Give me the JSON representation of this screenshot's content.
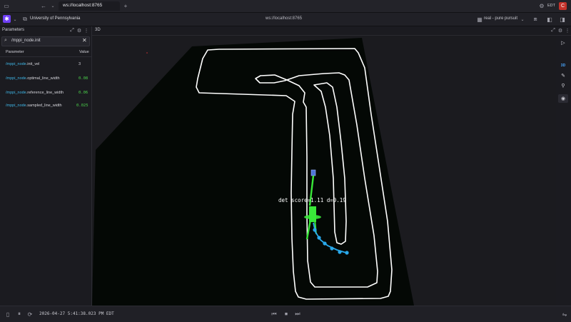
{
  "browser": {
    "tab_title": "ws://localhost:8765",
    "timezone_badge": "EDT",
    "profile_initial": "C",
    "new_tab_symbol": "+"
  },
  "appbar": {
    "org_name": "University of Pennsylvania",
    "url": "ws://localhost:8765",
    "layout_name": "real - pure pursuit"
  },
  "parameters_panel": {
    "title": "Parameters",
    "search_value": "/mppi_node.init",
    "columns": [
      "Parameter",
      "Value"
    ],
    "rows": [
      {
        "ns": "/mppi_node",
        "name": ".init_vel",
        "value": "3"
      },
      {
        "ns": "/mppi_node",
        "name": ".optimal_line_width",
        "value": "0.08"
      },
      {
        "ns": "/mppi_node",
        "name": ".reference_line_width",
        "value": "0.06"
      },
      {
        "ns": "/mppi_node",
        "name": ".sampled_line_width",
        "value": "0.025"
      }
    ]
  },
  "view3d": {
    "title": "3D",
    "overlay_text": "det score=1.11 d=0.19",
    "toolbar_mode": "3D"
  },
  "status": {
    "timestamp": "2026-04-27 5:41:38.023 PM EDT"
  },
  "colors": {
    "accent": "#6f3ff5",
    "track": "#ffffff",
    "path_green": "#39e839",
    "trajectory_blue": "#29a8ea",
    "profile_red": "#c4322a"
  }
}
